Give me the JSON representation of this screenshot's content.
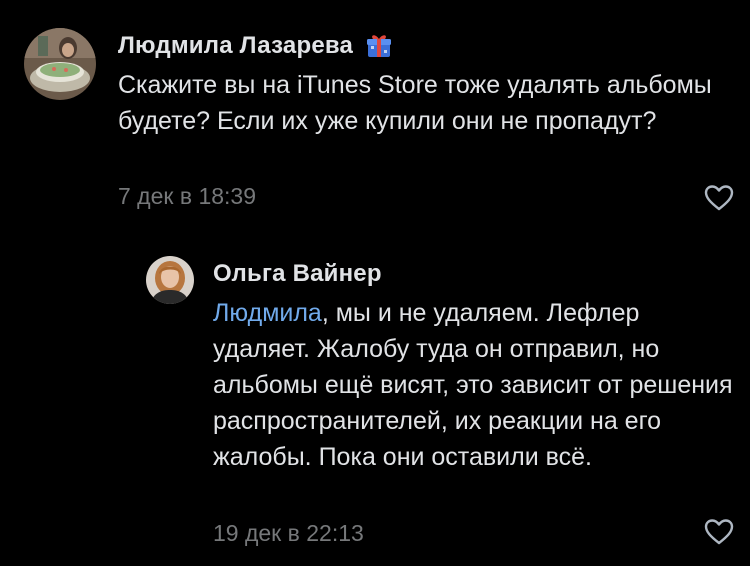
{
  "comments": [
    {
      "author": "Людмила Лазарева",
      "text": "Скажите вы на iTunes Store тоже удалять альбомы будете? Если их уже купили они не пропадут?",
      "timestamp": "7 дек в 18:39",
      "badge_icon": "gift-icon",
      "like_icon": "heart-outline-icon"
    },
    {
      "author": "Ольга Вайнер",
      "mention": "Людмила",
      "text": ", мы и не удаляем. Лефлер удаляет. Жалобу туда он отправил, но альбомы ещё висят, это зависит от решения распространителей, их реакции на его жалобы. Пока они оставили всё.",
      "timestamp": "19 дек в 22:13",
      "like_icon": "heart-outline-icon"
    }
  ],
  "colors": {
    "background": "#000000",
    "text": "#e1e3e6",
    "secondary": "#76787a",
    "link": "#71aaeb"
  }
}
